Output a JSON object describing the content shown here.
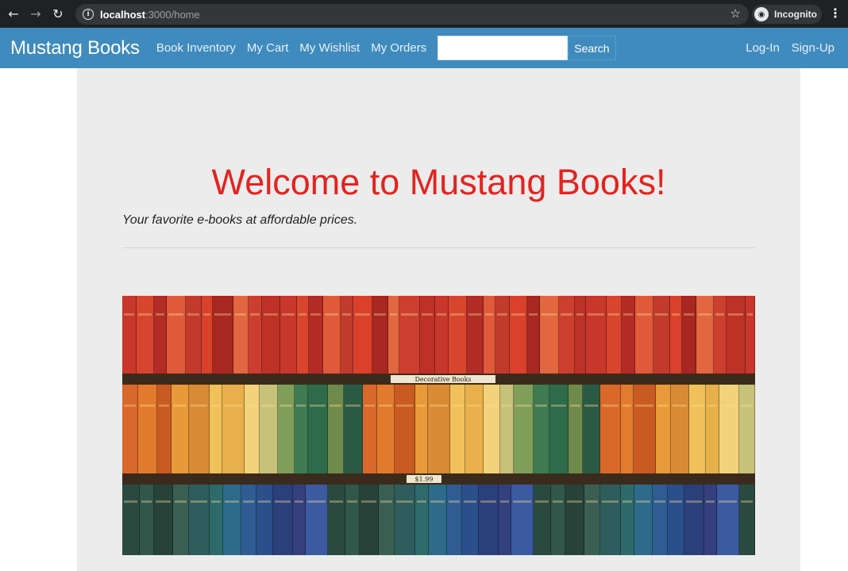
{
  "browser": {
    "back_icon": "arrow-left-icon",
    "forward_icon": "arrow-right-icon",
    "reload_icon": "reload-icon",
    "url_host": "localhost",
    "url_path": ":3000/home",
    "incognito_label": "Incognito"
  },
  "navbar": {
    "brand": "Mustang Books",
    "links": [
      "Book Inventory",
      "My Cart",
      "My Wishlist",
      "My Orders"
    ],
    "search_placeholder": "",
    "search_button": "Search",
    "login": "Log-In",
    "signup": "Sign-Up",
    "color": "#3f8bbd"
  },
  "hero": {
    "title": "Welcome to Mustang Books!",
    "subtitle": "Your favorite e-books at affordable prices.",
    "title_color": "#e3231f",
    "banner_labels": [
      "Decorative Books",
      "$1.99"
    ]
  }
}
